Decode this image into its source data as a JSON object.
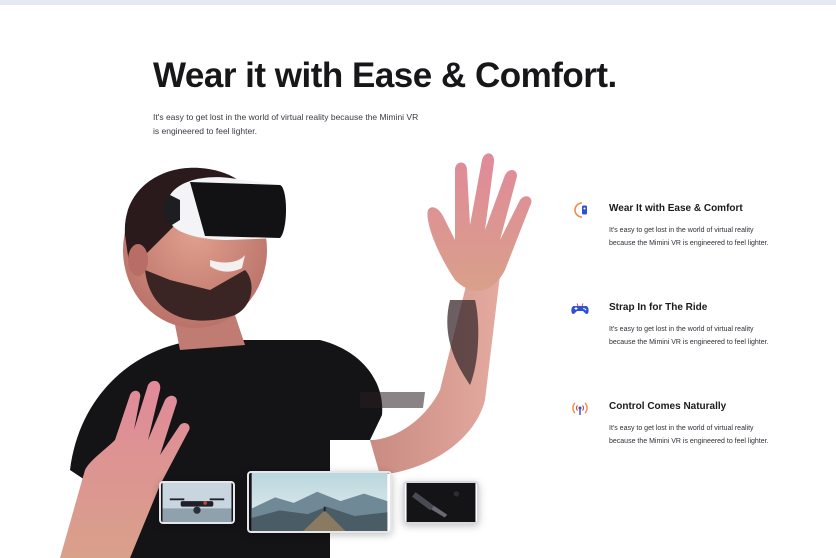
{
  "hero": {
    "title": "Wear it with Ease & Comfort.",
    "description": "It's easy to get lost in the world of virtual reality because the Mimini VR is engineered to feel lighter."
  },
  "features": [
    {
      "icon": "vr-headset-icon",
      "title": "Wear It with Ease & Comfort",
      "description": "It's easy to get lost in the world of virtual reality because the Mimini VR is engineered to feel lighter."
    },
    {
      "icon": "gamepad-icon",
      "title": "Strap In for The Ride",
      "description": "It's easy to get lost in the world of virtual reality because the Mimini VR is engineered to feel lighter."
    },
    {
      "icon": "signal-icon",
      "title": "Control Comes Naturally",
      "description": "It's easy to get lost in the world of virtual reality because the Mimini VR is engineered to feel lighter."
    }
  ],
  "colors": {
    "accent_orange": "#f08a4b",
    "accent_blue": "#2f4fd6",
    "accent_red": "#e2473a",
    "title": "#17171a"
  }
}
